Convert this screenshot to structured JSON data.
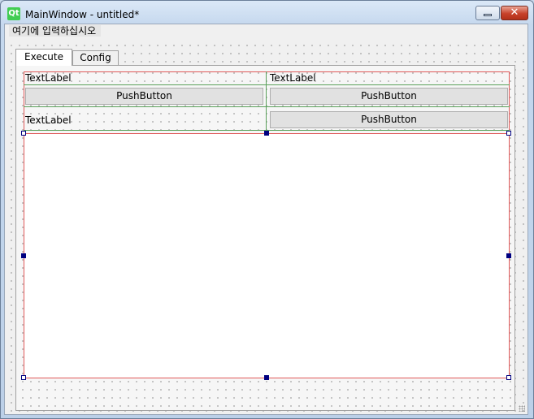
{
  "window": {
    "title": "MainWindow - untitled*",
    "logo_text": "Qt",
    "close_glyph": "✕"
  },
  "menubar": {
    "entry": "여기에 입력하십시오"
  },
  "tabs": [
    {
      "label": "Execute",
      "selected": true
    },
    {
      "label": "Config",
      "selected": false
    }
  ],
  "grid": {
    "row1": {
      "left_label": "TextLabel",
      "right_label": "TextLabel"
    },
    "row2": {
      "left_button": "PushButton",
      "right_button": "PushButton"
    },
    "row3": {
      "left_label": "TextLabel",
      "right_button": "PushButton"
    }
  },
  "colors": {
    "layout_border": "#e05a5a",
    "grid_lines": "#5aa05a",
    "selection_handle": "#000080",
    "close_button": "#c7412a"
  },
  "icons": [
    "qt-logo-icon",
    "minimize-icon",
    "close-icon",
    "resize-grip-icon"
  ]
}
